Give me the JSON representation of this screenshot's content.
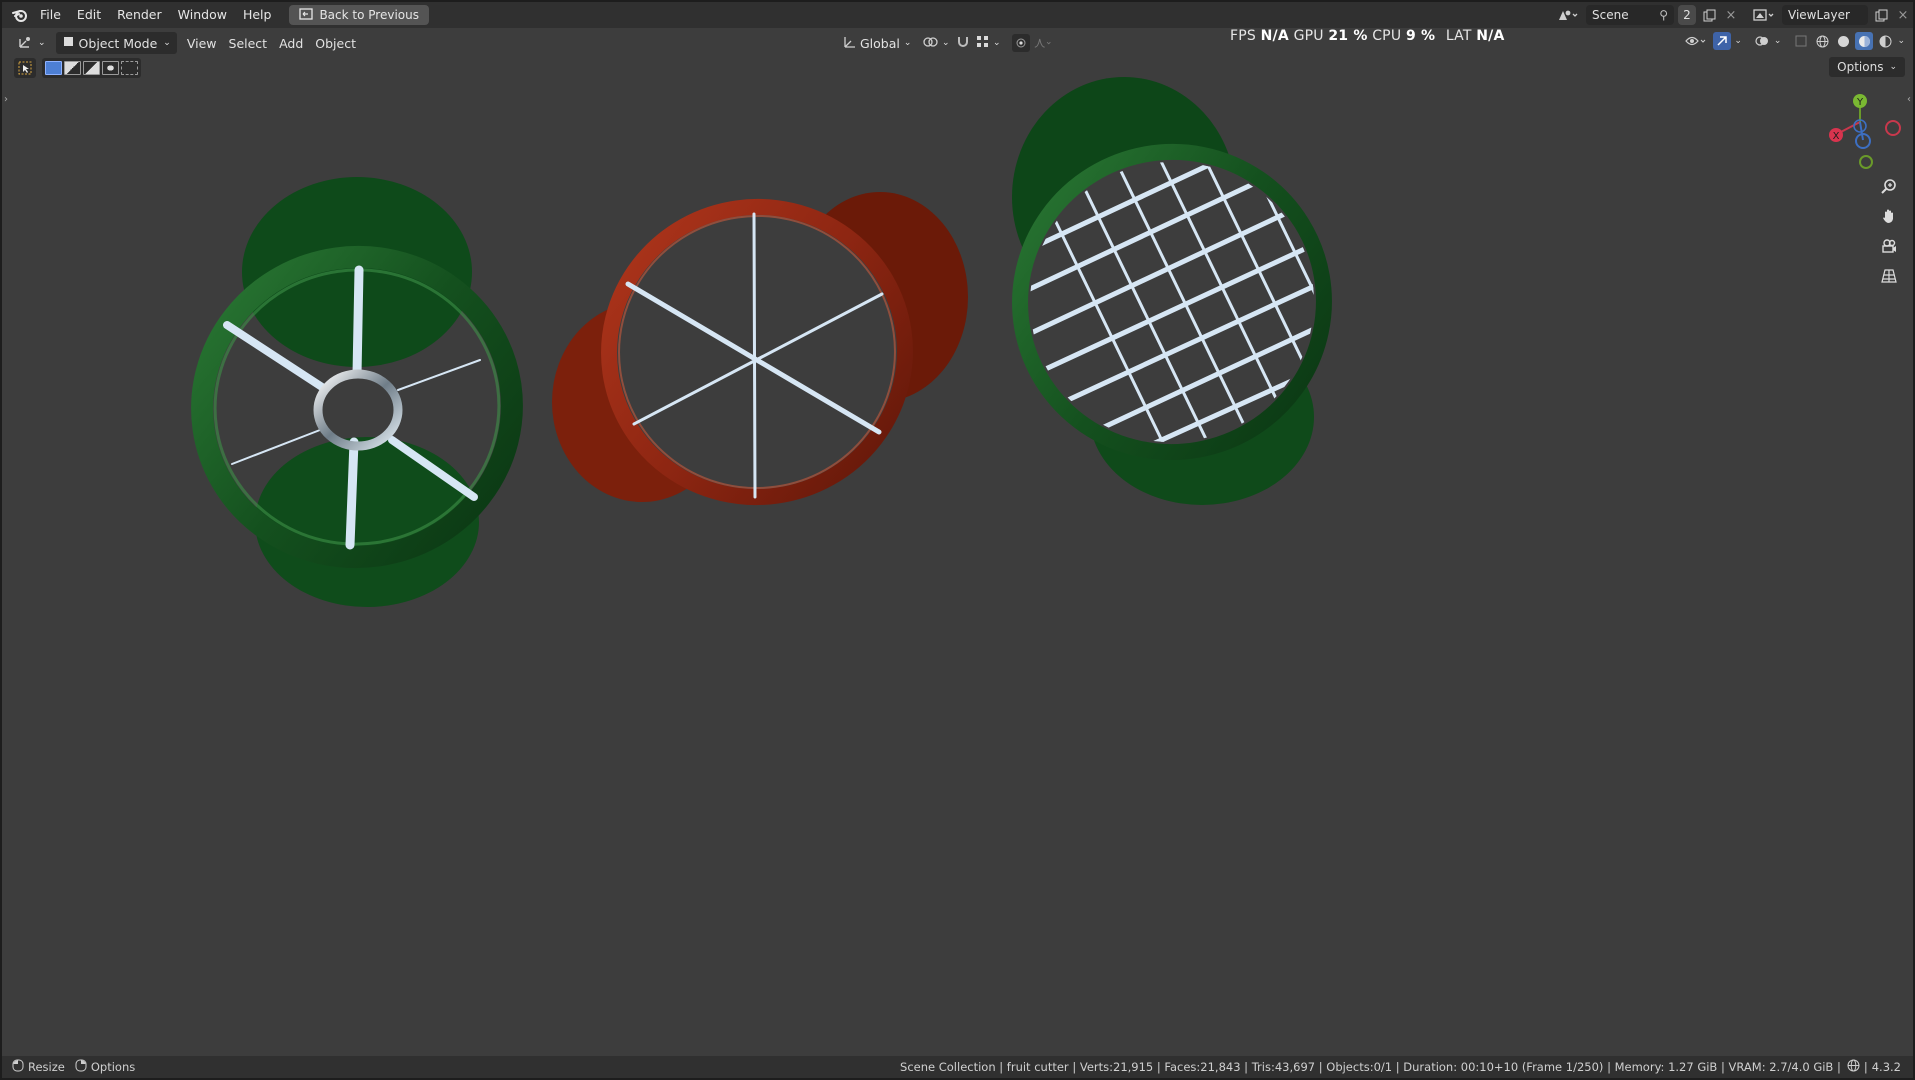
{
  "menu": {
    "file": "File",
    "edit": "Edit",
    "render": "Render",
    "window": "Window",
    "help": "Help",
    "back_button": "Back to Previous"
  },
  "topright": {
    "scene_name": "Scene",
    "scene_users": "2",
    "view_layer": "ViewLayer"
  },
  "header": {
    "mode": "Object Mode",
    "view": "View",
    "select": "Select",
    "add": "Add",
    "object": "Object",
    "transform_orientation": "Global",
    "options": "Options"
  },
  "stats": {
    "fps_label": "FPS",
    "fps_value": "N/A",
    "gpu_label": "GPU",
    "gpu_value": "21 %",
    "cpu_label": "CPU",
    "cpu_value": "9 %",
    "lat_label": "LAT",
    "lat_value": "N/A"
  },
  "gizmo": {
    "y_label": "Y",
    "x_label": "X"
  },
  "status": {
    "resize": "Resize",
    "options": "Options",
    "info": "Scene Collection | fruit cutter | Verts:21,915 | Faces:21,843 | Tris:43,697 | Objects:0/1 | Duration: 00:10+10 (Frame 1/250) | Memory: 1.27 GiB | VRAM: 2.7/4.0 GiB |",
    "version": "4.3.2"
  },
  "colors": {
    "green": "#1b5a26",
    "green_dark": "#10441a",
    "red": "#8a2410",
    "red_dark": "#6a1808",
    "blade": "#c7dcf0",
    "background": "#3d3d3d"
  }
}
